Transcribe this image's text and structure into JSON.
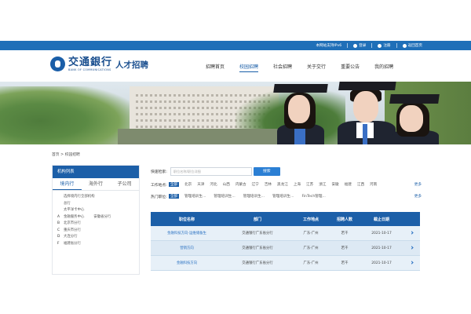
{
  "topbar": {
    "ipv6": "本网站支持IPv6",
    "login": "登录",
    "register": "注册",
    "back_home": "返回首页"
  },
  "brand": {
    "name_cn": "交通銀行",
    "name_en": "BANK OF COMMUNICATIONS",
    "subtitle": "人才招聘",
    "color": "#1a4f8f"
  },
  "nav": {
    "items": [
      {
        "label": "招聘首页"
      },
      {
        "label": "校园招聘"
      },
      {
        "label": "社会招聘"
      },
      {
        "label": "关于交行"
      },
      {
        "label": "重要公告"
      },
      {
        "label": "我的招聘"
      }
    ],
    "active_index": 1
  },
  "breadcrumb": "首页 > 校园招聘",
  "sidebar": {
    "header": "机构列表",
    "tabs": [
      {
        "label": "境内行"
      },
      {
        "label": "海外行"
      },
      {
        "label": "子公司"
      }
    ],
    "lines": [
      {
        "letter": "",
        "text": "选择境内行全部机构",
        "extra": ""
      },
      {
        "letter": "",
        "text": "总行",
        "extra": ""
      },
      {
        "letter": "",
        "text": "太平洋卡中心",
        "extra": ""
      },
      {
        "letter": "A",
        "text": "金融服务中心",
        "extra": "安徽省分行"
      },
      {
        "letter": "B",
        "text": "北京市分行",
        "extra": ""
      },
      {
        "letter": "C",
        "text": "重庆市分行",
        "extra": ""
      },
      {
        "letter": "D",
        "text": "大连分行",
        "extra": ""
      },
      {
        "letter": "F",
        "text": "福建省分行",
        "extra": ""
      }
    ]
  },
  "search": {
    "label": "快速检索:",
    "placeholder": "职位名称/职位详细",
    "button": "搜索"
  },
  "filters": {
    "location_label": "工作地点:",
    "locations": [
      "全部",
      "北京",
      "天津",
      "河北",
      "山西",
      "内蒙古",
      "辽宁",
      "吉林",
      "黑龙江",
      "上海",
      "江苏",
      "浙江",
      "安徽",
      "福建",
      "江西",
      "河南"
    ],
    "category_label": "热门职位:",
    "categories": [
      "全部",
      "管理培训生...",
      "管理培训生...",
      "管理培训生...",
      "管理培训生...",
      "FinTech管理..."
    ],
    "more": "更多"
  },
  "table": {
    "headers": [
      "职位名称",
      "部门",
      "工作地点",
      "招聘人数",
      "截止日期"
    ],
    "rows": [
      [
        "金融科技方向-运维储备生",
        "交通银行广东省分行",
        "广东-广州",
        "若干",
        "2021-10-17"
      ],
      [
        "营销方向",
        "交通银行广东省分行",
        "广东-广州",
        "若干",
        "2021-10-17"
      ],
      [
        "金融科技方向",
        "交通银行广东省分行",
        "广东-广州",
        "若干",
        "2021-10-17"
      ]
    ]
  },
  "colors": {
    "primary": "#1c5fa8",
    "topbar": "#1f6fb8",
    "search_button": "#2b7fd4"
  }
}
